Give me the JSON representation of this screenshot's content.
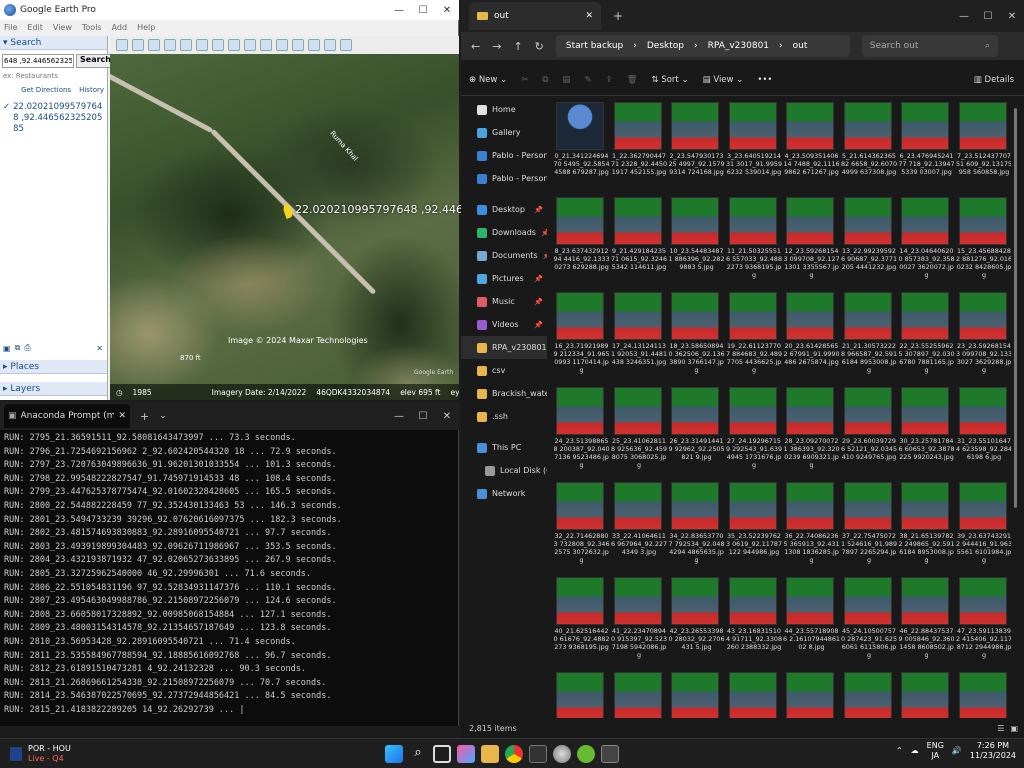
{
  "google_earth": {
    "title": "Google Earth Pro",
    "menu": [
      "File",
      "Edit",
      "View",
      "Tools",
      "Add",
      "Help"
    ],
    "search_header": "Search",
    "search_value": "648 ,92.44656232520585",
    "search_button": "Search",
    "example": "ex: Restaurants",
    "get_directions": "Get Directions",
    "history": "History",
    "result": "22.020210995797648 ,92.44656232520585",
    "places": "Places",
    "layers": "Layers",
    "pin_label": "22.020210995797648 ,92.4465623",
    "road_label": "Ruma Khal",
    "imagery_credit": "Image © 2024 Maxar Technologies",
    "scale": "870 ft",
    "status_year": "1985",
    "imagery_date": "Imagery Date: 2/14/2022",
    "grid": "46QDK4332034874",
    "elev": "elev 695 ft",
    "eye_alt": "eye alt 4296 ft",
    "watermark": "Google Earth"
  },
  "console": {
    "tab_title": "Anaconda Prompt (minicond",
    "lines": [
      "RUN: 2795_21.36591511_92.58081643473997 ... 73.3 seconds.",
      "RUN: 2796_21.7254692156962 2_92.602420544320 18 ... 72.9 seconds.",
      "RUN: 2797_23.720763049896636_91.96201301033554 ... 101.3 seconds.",
      "RUN: 2798_22.99548222827547_91.745971914533 48 ... 108.4 seconds.",
      "RUN: 2799_23.447625378775474_92.01602328428605 ... 165.5 seconds.",
      "RUN: 2800_22.544882228459 77_92.352430133463 53 ... 146.3 seconds.",
      "RUN: 2801_23.5494733239 39296_92.07620616097375 ... 182.3 seconds.",
      "RUN: 2802_23.481574693830883_92.28916095540721 ... 97.7 seconds.",
      "RUN: 2803_23.493919899304483_92.09626711986967 ... 353.5 seconds.",
      "RUN: 2804_23.432193871932 47_92.02065273633895 ... 267.9 seconds.",
      "RUN: 2805_23.32725962540000 46_92.29996301 ... 71.6 seconds.",
      "RUN: 2806_22.551054831196 97_92.52834931147376 ... 110.1 seconds.",
      "RUN: 2807_23.495463049988786_92.21508972256079 ... 124.6 seconds.",
      "RUN: 2808_23.66058017328892_92.00985068154884 ... 127.1 seconds.",
      "RUN: 2809_23.48003154314578_92.21354657187649 ... 123.8 seconds.",
      "RUN: 2810_23.56953428_92.28916095540721 ... 71.4 seconds.",
      "RUN: 2811_23.535584967788594_92.18885616092768 ... 96.7 seconds.",
      "RUN: 2812_23.61891510473281 4_92.24132328 ... 90.3 seconds.",
      "RUN: 2813_21.26869661254338_92.21508972256079 ... 70.7 seconds.",
      "RUN: 2814_23.546387022570695_92.27372944856421 ... 84.5 seconds.",
      "RUN: 2815_21.4183822289205 14_92.26292739 ... |"
    ]
  },
  "explorer": {
    "tab_title": "out",
    "address": [
      "Start backup",
      "Desktop",
      "RPA_v230801",
      "out"
    ],
    "search_placeholder": "Search out",
    "commands": [
      "New",
      "Sort",
      "View",
      "Details"
    ],
    "nav": [
      {
        "label": "Home",
        "color": "#e0e0e0",
        "pin": false
      },
      {
        "label": "Gallery",
        "color": "#4aa3df",
        "pin": false
      },
      {
        "label": "Pablo - Personal",
        "color": "#3b7fd4",
        "pin": false
      },
      {
        "label": "Pablo - Personal",
        "color": "#3b7fd4",
        "pin": false
      },
      {
        "label": "Desktop",
        "color": "#3b8fe0",
        "pin": true
      },
      {
        "label": "Downloads",
        "color": "#2fb36b",
        "pin": true
      },
      {
        "label": "Documents",
        "color": "#7aa6d6",
        "pin": true
      },
      {
        "label": "Pictures",
        "color": "#4fa6e0",
        "pin": true
      },
      {
        "label": "Music",
        "color": "#e05a6a",
        "pin": true
      },
      {
        "label": "Videos",
        "color": "#9a5ad0",
        "pin": true
      },
      {
        "label": "RPA_v230801",
        "color": "#e8b64a",
        "pin": false
      },
      {
        "label": "csv",
        "color": "#e8b64a",
        "pin": false
      },
      {
        "label": "Brackish_water_aqu",
        "color": "#e8b64a",
        "pin": false
      },
      {
        "label": ".ssh",
        "color": "#e8b64a",
        "pin": false
      },
      {
        "label": "This PC",
        "color": "#4a8fd8",
        "pin": false
      },
      {
        "label": "Local Disk (C:)",
        "color": "#999",
        "pin": false
      },
      {
        "label": "Network",
        "color": "#4a8fd8",
        "pin": false
      }
    ],
    "files": [
      "0_21.34122469470 5495_92.58544588 679287.jpg",
      "1_22.36279044771 2328_92.44501917 452155.jpg",
      "2_23.54793017325 4997_92.15799314 724168.jpg",
      "3_23.64051921431 3017_91.99596232 539014.jpg",
      "4_23.50935140614 7488_92.11169862 671267.jpg",
      "5_21.61436236582 6658_92.60704999 637308.jpg",
      "6_23.47694524177 718_92.139475339 03007.jpg",
      "7_23.51243770751 609_92.13175958 560858.jpg",
      "8_23.63743291294 4416_92.13330273 629288.jpg",
      "9_21.42918423571 0615_92.32465342 114611.jpg",
      "10_23.544834871 886396_92.2829883 5.jpg",
      "11_21.503255516 557033_92.4882273 9368195.jpg",
      "12_23.592681543 099708_92.1271301 3355567.jpg",
      "13_22.992395926 90687_92.3771205 4441232.jpg",
      "14_23.046406200 857383_92.3580027 3620072.jpg",
      "15_23.456884282 881276_92.0160232 8428605.jpg",
      "16_23.719219899 212334_91.9650993 1170414.jpg",
      "17_24.131241131 92053_91.4481438 3246351.jpg",
      "18_23.586508940 362506_92.1363890 3766147.jpg",
      "19_22.611237707 884683_92.4897705 4436625.jpg",
      "20_23.614285652 67991_91.9990486 2675874.jpg",
      "21_21.305732228 966587_92.5916184 8953008.jpg",
      "22_23.552559625 307897_92.0306780 7881165.jpg",
      "23_23.592681543 099708_92.1333027 3629288.jpg",
      "24_23.513988658 200387_92.0407136 9523486.jpg",
      "25_23.410628118 925636_92.4598075 3068025.jpg",
      "26_23.314914419 92962_92.2505821 9.jpg",
      "27_24.192967159 292543_91.6394945 1731676.jpg",
      "28_23.092700721 386393_92.3200239 6909321.jpg",
      "29_23.600397296 52121_92.0345410 9249765.jpg",
      "30_23.257817846 60653_92.3878225 9920243.jpg",
      "31_23.551016474 623598_92.2846198 6.jpg",
      "32_22.714628803 732808_92.3462575 3072632.jpg",
      "33_22.410646116 967964_92.2274349 3.jpg",
      "34_22.836537707 792534_92.0484294 4865635.jpg",
      "35_23.522397623 0619_92.11787122 944986.jpg",
      "36_22.740862365 365913_92.4311308 1836285.jpg",
      "37_22.754750721 524616_91.9897897 2265294.jpg",
      "38_21.651397822 249865_92.5916184 8953008.jpg",
      "39_23.637432912 944416_91.9635561 6101984.jpg",
      "40_21.625164420 61676_92.4882273 9368195.jpg",
      "41_22.234708940 915397_92.5237198 5942086.jpg",
      "42_23.265533980 28032_92.2706431 5.jpg",
      "43_23.168315104 91711_92.3308260 2388332.jpg",
      "44_23.557189086 2.1610794486102 8.jpg",
      "45_24.105007570 287423_91.6256061 6115806.jpg",
      "46_22.884375379 005846_92.3601458 8608502.jpg",
      "47_23.591138392 415406_92.1178712 2944986.jpg",
      "",
      "",
      "",
      "",
      "",
      "",
      "",
      ""
    ],
    "item_count": "2,815 items"
  },
  "taskbar": {
    "sports_line1": "POR - HOU",
    "sports_line2": "Live - Q4",
    "lang1": "ENG",
    "lang2": "JA",
    "time": "7:26 PM",
    "date": "11/23/2024"
  }
}
